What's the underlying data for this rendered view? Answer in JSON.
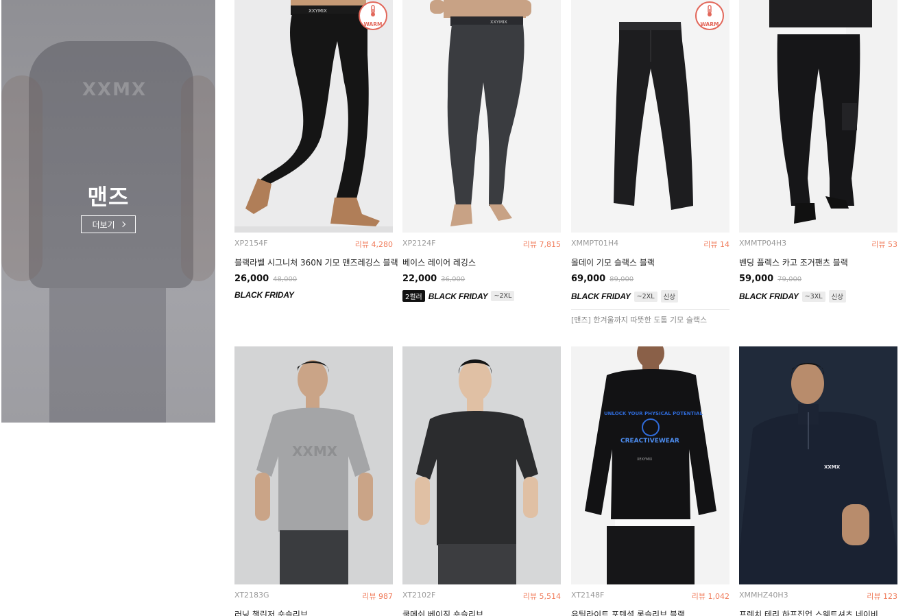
{
  "banner": {
    "title": "맨즈",
    "more_label": "더보기",
    "bg_logo": "XXMX"
  },
  "products": [
    {
      "code": "XP2154F",
      "review": "리뷰 4,280",
      "name": "블랙라벨 시그니처 360N 기모 맨즈레깅스 블랙",
      "price": "26,000",
      "original_price": "48,000",
      "badge": "WARM",
      "brand_label": "BLACK FRIDAY",
      "waistband_text": "XXYMIX",
      "tags": []
    },
    {
      "code": "XP2124F",
      "review": "리뷰 7,815",
      "name": "베이스 레이어 레깅스",
      "price": "22,000",
      "original_price": "36,000",
      "color_tag": "2컬러",
      "brand_label": "BLACK FRIDAY",
      "waistband_text": "XXYMIX",
      "tags": [
        "~2XL"
      ]
    },
    {
      "code": "XMMPT01H4",
      "review": "리뷰 14",
      "name": "올데이 기모 슬랙스 블랙",
      "price": "69,000",
      "original_price": "89,000",
      "badge": "WARM",
      "brand_label": "BLACK FRIDAY",
      "tags": [
        "~2XL",
        "신상"
      ],
      "description": "[맨즈] 한겨울까지 따뜻한 도톰 기모 슬랙스"
    },
    {
      "code": "XMMTP04H3",
      "review": "리뷰 53",
      "name": "벤딩 플렉스 카고 조거팬츠 블랙",
      "price": "59,000",
      "original_price": "79,000",
      "brand_label": "BLACK FRIDAY",
      "tags": [
        "~3XL",
        "신상"
      ]
    },
    {
      "code": "XT2183G",
      "review": "리뷰 987",
      "name": "러닝 챌린저 숏슬리브",
      "shirt_print": "XXMX"
    },
    {
      "code": "XT2102F",
      "review": "리뷰 5,514",
      "name": "쿨메쉬 베이직 숏슬리브"
    },
    {
      "code": "XT2148F",
      "review": "리뷰 1,042",
      "name": "유틸라이트 포텐셜 롱슬리브 블랙",
      "print_line1": "UNLOCK YOUR PHYSICAL POTENTIAL",
      "print_main": "CREACTIVEWEAR",
      "print_small": "XEXYMIX"
    },
    {
      "code": "XMMHZ40H3",
      "review": "리뷰 123",
      "name": "프렌치 테리 하프집업 스웨트셔츠 네이비",
      "chest_logo": "XXMX"
    }
  ],
  "colors": {
    "review": "#f07b5a",
    "warm_badge": "#e2675a",
    "navy": "#1c2533"
  }
}
